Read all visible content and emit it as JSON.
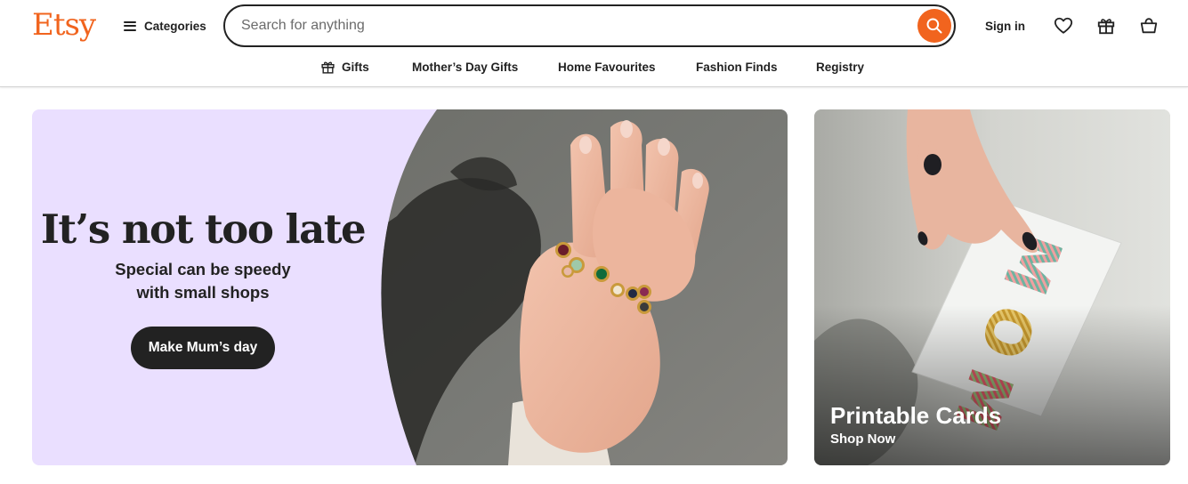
{
  "header": {
    "logo": "Etsy",
    "categories_label": "Categories",
    "search": {
      "placeholder": "Search for anything",
      "value": ""
    },
    "sign_in": "Sign in",
    "icons": [
      "hamburger-icon",
      "search-icon",
      "heart-icon",
      "gift-icon",
      "basket-icon"
    ]
  },
  "subnav": {
    "items": [
      {
        "label": "Gifts",
        "icon": "gift-icon"
      },
      {
        "label": "Mother’s Day Gifts"
      },
      {
        "label": "Home Favourites"
      },
      {
        "label": "Fashion Finds"
      },
      {
        "label": "Registry"
      }
    ]
  },
  "hero": {
    "title": "It’s not too late",
    "subtitle_line1": "Special can be speedy",
    "subtitle_line2": "with small shops",
    "cta": "Make Mum’s day"
  },
  "card": {
    "title": "Printable Cards",
    "link": "Shop Now",
    "card_text": "MOM"
  },
  "colors": {
    "brand_orange": "#f1641e",
    "hero_background": "#eadfff",
    "text_dark": "#222222",
    "button_dark": "#222222"
  }
}
